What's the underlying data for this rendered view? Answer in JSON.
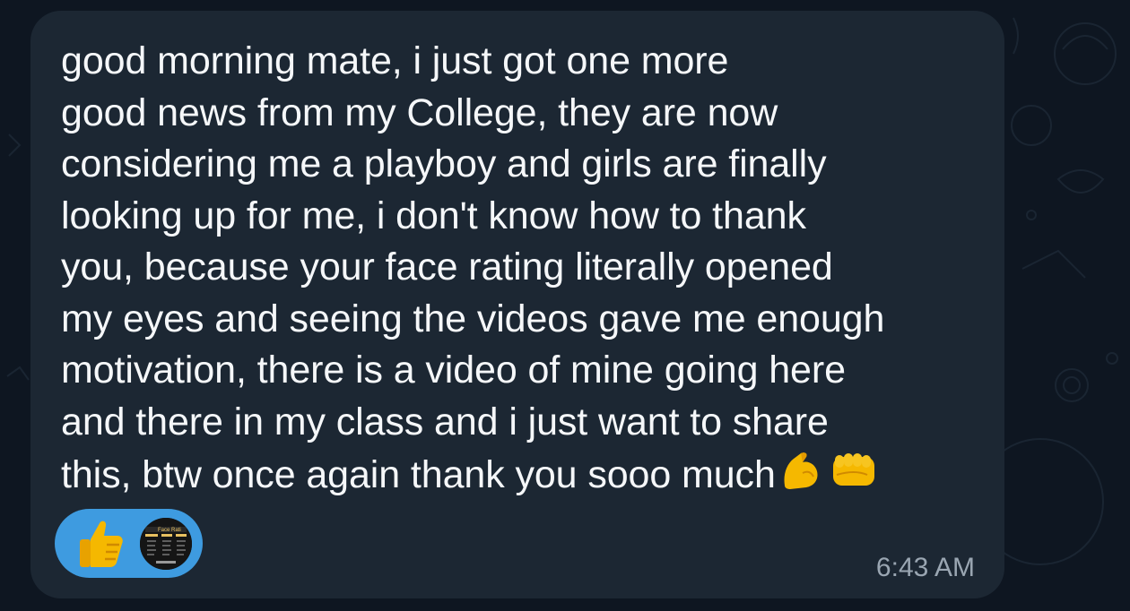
{
  "message": {
    "text": "good morning mate, i just got one more\ngood news from my College, they are now\nconsidering me a playboy and girls are finally\nlooking up for me, i don't know how to thank\nyou, because your face rating literally opened\nmy eyes and seeing the videos gave me enough\nmotivation, there is a video of mine going here\nand there in my class and i just want to share\nthis, btw once again thank you sooo much",
    "trailing_emojis": [
      "flexed-biceps",
      "oncoming-fist"
    ],
    "time": "6:43 AM"
  },
  "reaction": {
    "emoji": "thumbs-up",
    "avatar_label": "Face Rati"
  },
  "colors": {
    "background": "#0e1621",
    "bubble": "#1c2733",
    "text": "#f5f7f9",
    "reaction_pill": "#3e9be0",
    "timestamp": "#9aa6b2"
  }
}
